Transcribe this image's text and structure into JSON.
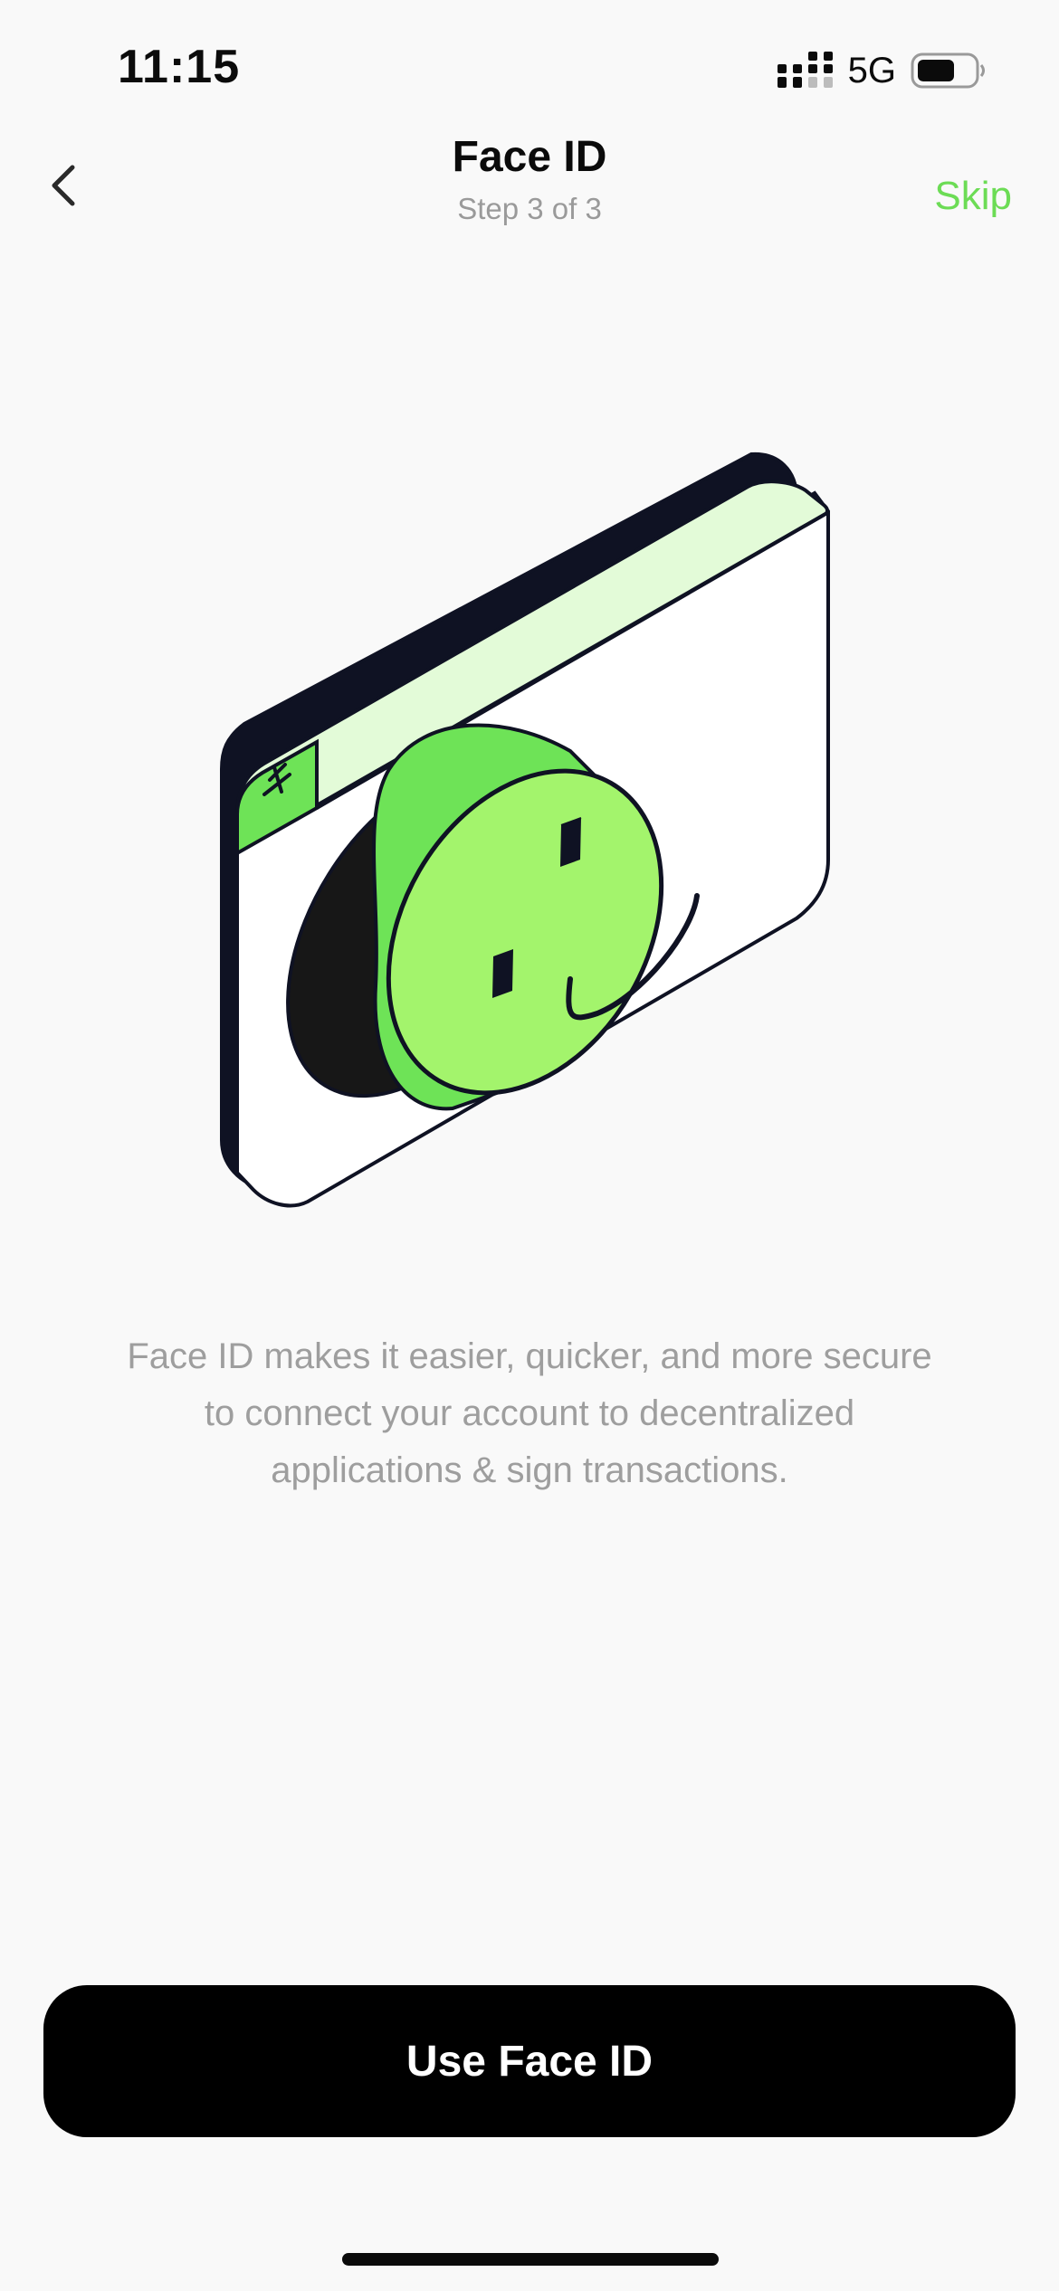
{
  "status_bar": {
    "time": "11:15",
    "network": "5G",
    "icons": [
      "signal-icon",
      "battery-icon"
    ]
  },
  "header": {
    "title": "Face ID",
    "subtitle": "Step 3 of 3",
    "skip_label": "Skip",
    "back_icon": "chevron-left-icon"
  },
  "illustration": {
    "icon": "face-id-illustration",
    "colors": {
      "outline": "#0f1223",
      "green": "#6ee357",
      "light_green": "#a3f46c",
      "pale_green": "#e3fbd8",
      "white": "#ffffff"
    }
  },
  "main": {
    "description": "Face ID makes it easier, quicker, and more secure to connect your account to decentralized applications & sign transactions."
  },
  "footer": {
    "button_label": "Use Face ID"
  },
  "colors": {
    "accent": "#6cdc55",
    "background": "#f9f9f9",
    "button_bg": "#000000",
    "muted_text": "#9e9e9e"
  }
}
